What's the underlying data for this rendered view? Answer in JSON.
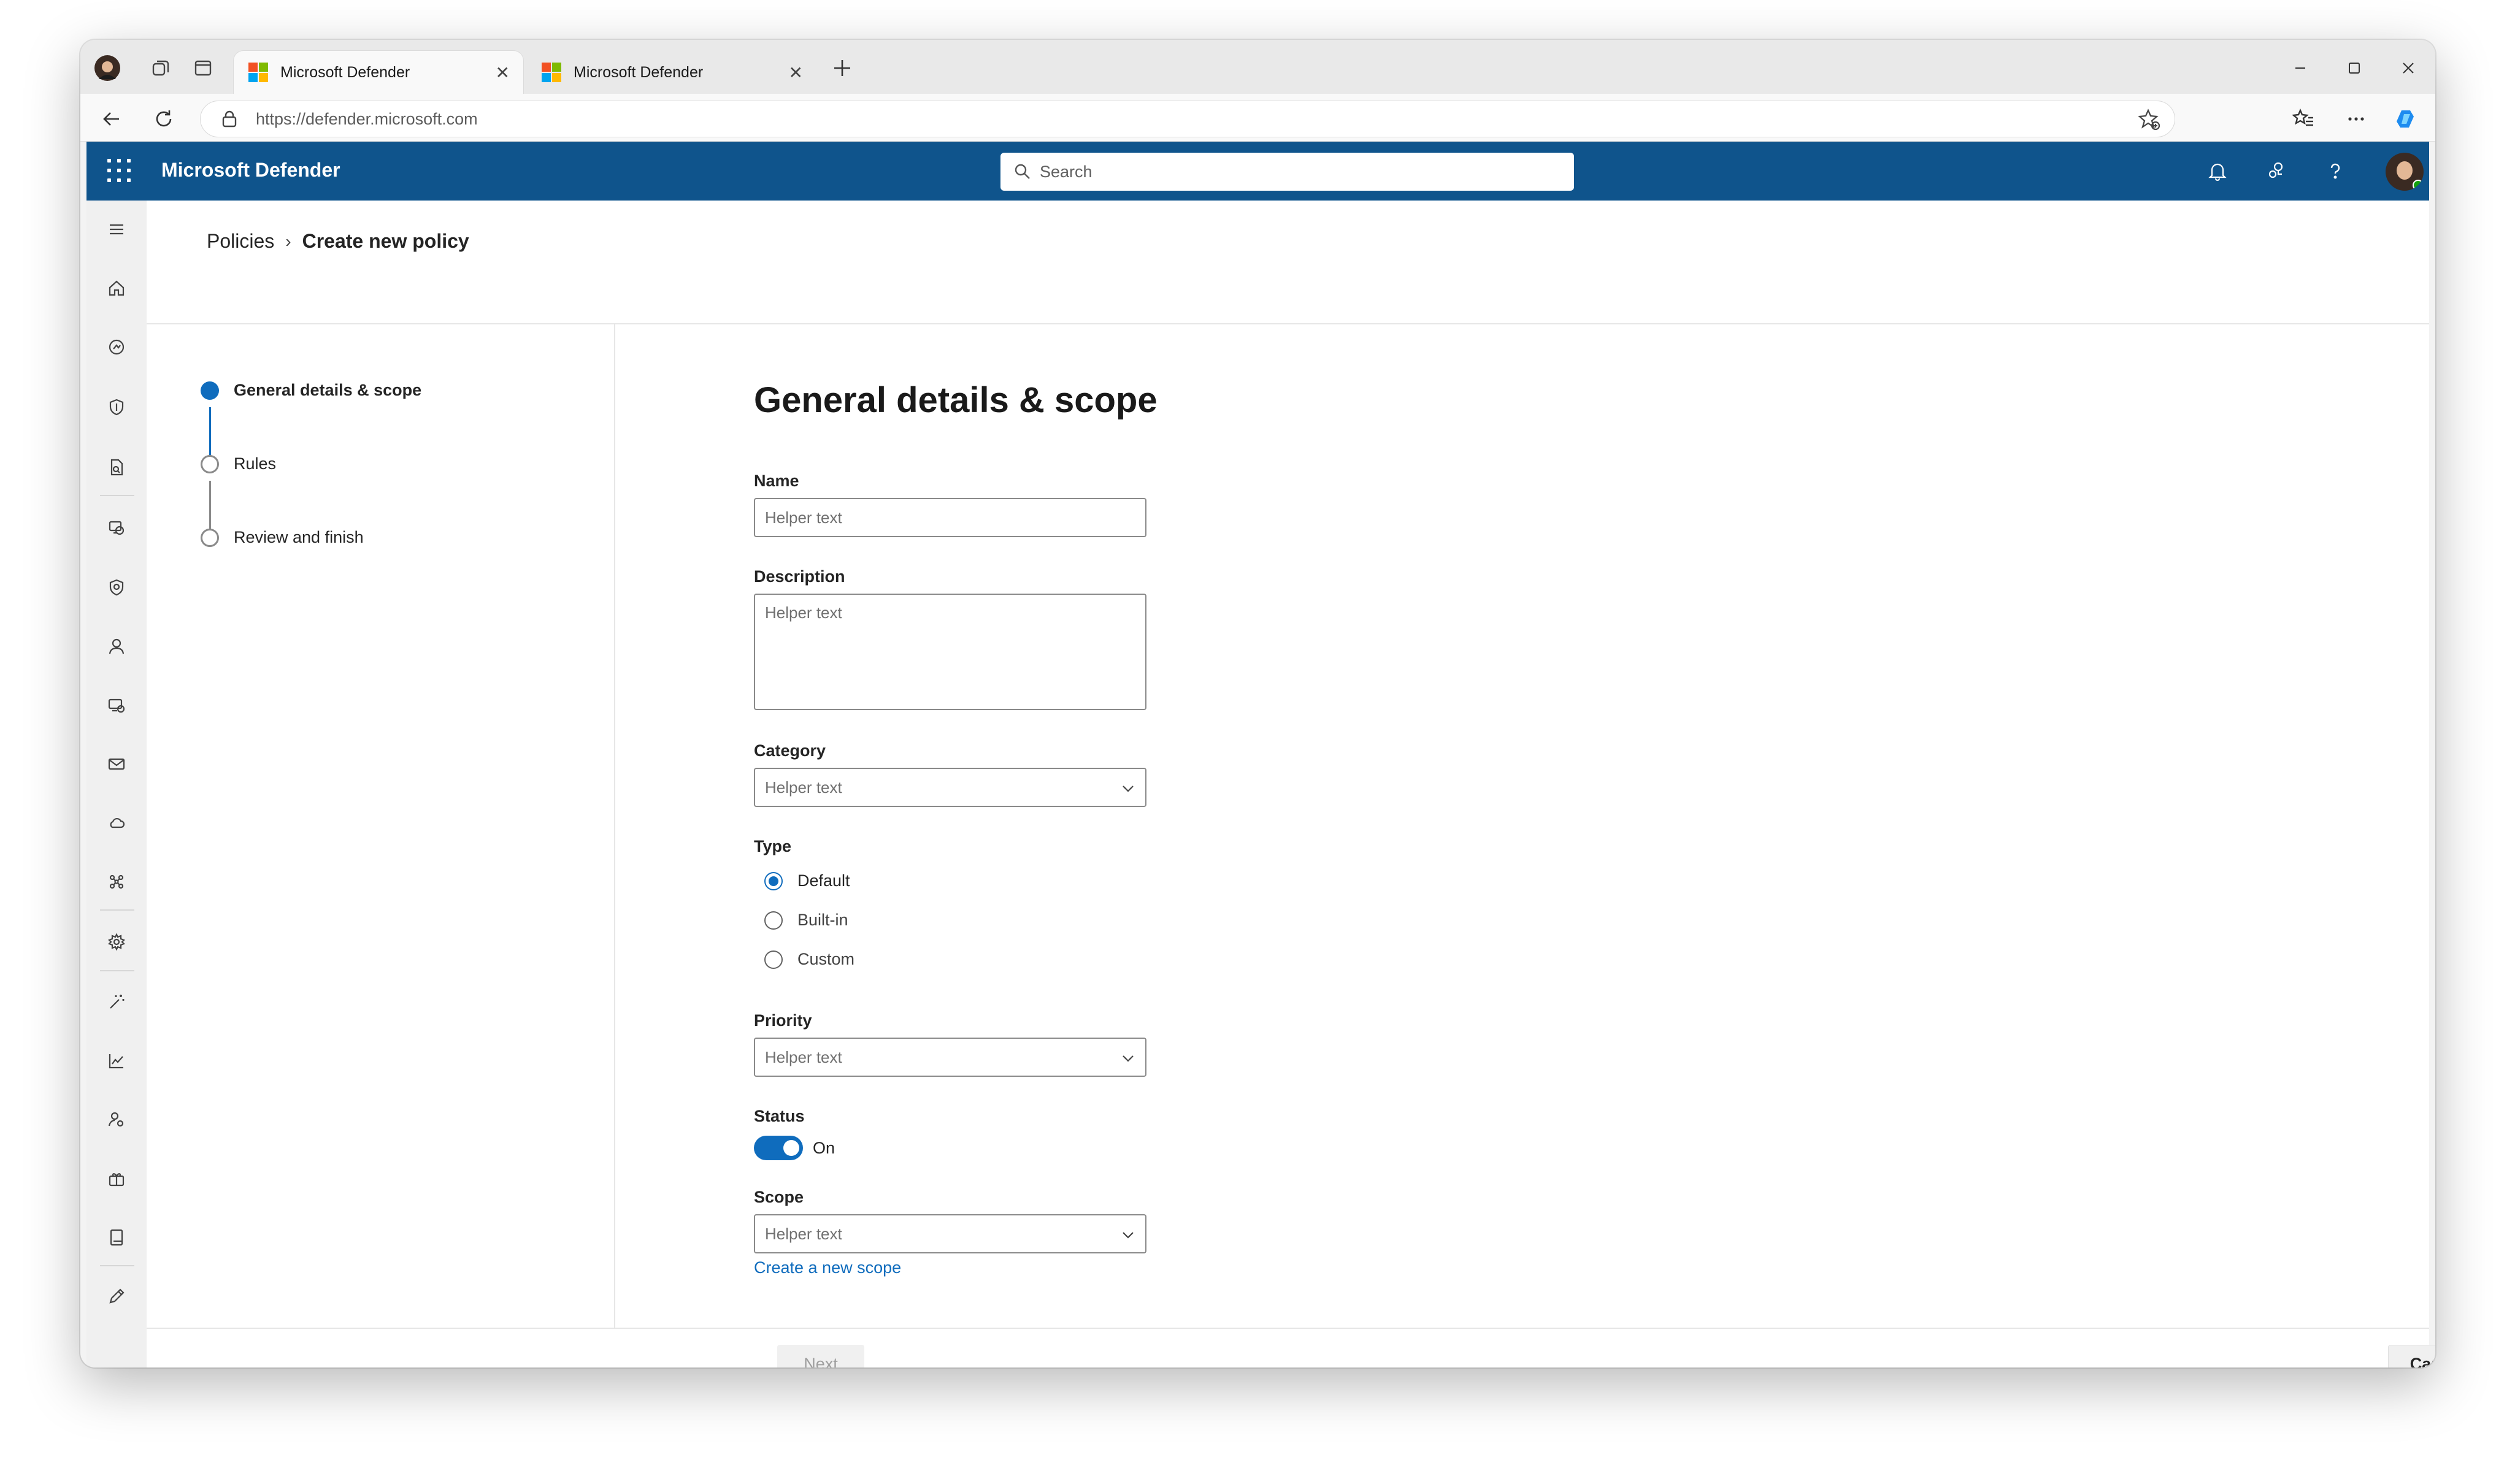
{
  "browser": {
    "tabs": [
      {
        "title": "Microsoft Defender",
        "active": true
      },
      {
        "title": "Microsoft Defender",
        "active": false
      }
    ],
    "url": "https://defender.microsoft.com"
  },
  "header": {
    "app_title": "Microsoft Defender",
    "search_placeholder": "Search",
    "accent_color": "#0f548c"
  },
  "breadcrumb": {
    "parent": "Policies",
    "current": "Create new policy"
  },
  "stepper": {
    "steps": [
      "General details & scope",
      "Rules",
      "Review and finish"
    ],
    "active_index": 0
  },
  "form": {
    "title": "General details & scope",
    "name": {
      "label": "Name",
      "placeholder": "Helper text"
    },
    "description": {
      "label": "Description",
      "placeholder": "Helper text"
    },
    "category": {
      "label": "Category",
      "value": "Helper text"
    },
    "type": {
      "label": "Type",
      "options": [
        "Default",
        "Built-in",
        "Custom"
      ],
      "selected": "Default"
    },
    "priority": {
      "label": "Priority",
      "value": "Helper text"
    },
    "status": {
      "label": "Status",
      "value": "On",
      "enabled": true
    },
    "scope": {
      "label": "Scope",
      "value": "Helper text",
      "link": "Create a new scope"
    }
  },
  "footer": {
    "next_label": "Next",
    "cancel_label": "Cancel"
  },
  "icons": {
    "rail": [
      "menu-icon",
      "home-icon",
      "incidents-icon",
      "shield-icon",
      "reports-doc-icon",
      "assets-icon",
      "security-shield-icon",
      "person-icon",
      "devices-icon",
      "mail-icon",
      "cloud-icon",
      "connections-icon",
      "settings-icon",
      "wand-icon",
      "chart-icon",
      "people-settings-icon",
      "gift-icon",
      "book-icon",
      "pencil-icon"
    ]
  }
}
